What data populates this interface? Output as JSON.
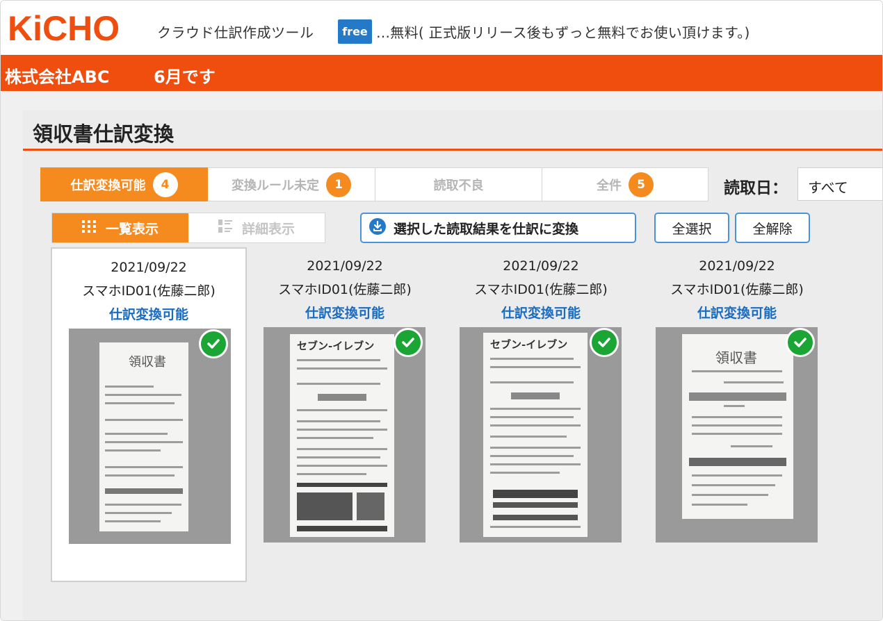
{
  "header": {
    "logo_text": "KiCHO",
    "tagline": "クラウド仕訳作成ツール",
    "free_badge": "free",
    "free_note": "…無料( 正式版リリース後もずっと無料でお使い頂けます。)"
  },
  "company": {
    "name": "株式会社ABC",
    "month": "6月です"
  },
  "page": {
    "title": "領収書仕訳変換"
  },
  "tabs": [
    {
      "label": "仕訳変換可能",
      "count": "4",
      "active": true
    },
    {
      "label": "変換ルール未定",
      "count": "1",
      "active": false
    },
    {
      "label": "読取不良",
      "count": "",
      "active": false
    },
    {
      "label": "全件",
      "count": "5",
      "active": false
    }
  ],
  "read_date": {
    "label": "読取日：",
    "value": "すべて"
  },
  "view": {
    "list_label": "一覧表示",
    "detail_label": "詳細表示"
  },
  "actions": {
    "convert": "選択した読取結果を仕訳に変換",
    "select_all": "全選択",
    "deselect_all": "全解除"
  },
  "cards": [
    {
      "date": "2021/09/22",
      "device": "スマホID01(佐藤二郎)",
      "status": "仕訳変換可能",
      "receipt_title": "領収書",
      "selected": true
    },
    {
      "date": "2021/09/22",
      "device": "スマホID01(佐藤二郎)",
      "status": "仕訳変換可能",
      "receipt_title": "セブン-イレブン",
      "selected": false
    },
    {
      "date": "2021/09/22",
      "device": "スマホID01(佐藤二郎)",
      "status": "仕訳変換可能",
      "receipt_title": "セブン-イレブン",
      "selected": false
    },
    {
      "date": "2021/09/22",
      "device": "スマホID01(佐藤二郎)",
      "status": "仕訳変換可能",
      "receipt_title": "領収書",
      "selected": false
    }
  ],
  "colors": {
    "brand_orange": "#f04e0f",
    "tab_orange": "#f58a1f",
    "link_blue": "#1a6cc0",
    "badge_blue": "#2479c8",
    "check_green": "#1aa534"
  }
}
